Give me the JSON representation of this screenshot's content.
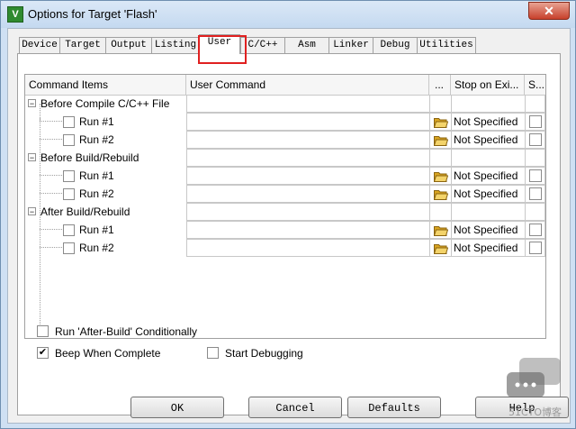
{
  "window": {
    "icon_letter": "V",
    "title": "Options for Target 'Flash'",
    "close_glyph": "✕"
  },
  "tabs": [
    {
      "label": "Device",
      "active": false
    },
    {
      "label": "Target",
      "active": false
    },
    {
      "label": "Output",
      "active": false
    },
    {
      "label": "Listing",
      "active": false
    },
    {
      "label": "User",
      "active": true
    },
    {
      "label": "C/C++",
      "active": false
    },
    {
      "label": "Asm",
      "active": false
    },
    {
      "label": "Linker",
      "active": false
    },
    {
      "label": "Debug",
      "active": false
    },
    {
      "label": "Utilities",
      "active": false
    }
  ],
  "grid": {
    "columns": {
      "items": "Command Items",
      "command": "User Command",
      "browse": "...",
      "stop": "Stop on Exi...",
      "s": "S..."
    },
    "groups": [
      {
        "label": "Before Compile C/C++ File",
        "expander": "−",
        "runs": [
          {
            "label": "Run #1",
            "command": "",
            "stop": "Not Specified"
          },
          {
            "label": "Run #2",
            "command": "",
            "stop": "Not Specified"
          }
        ]
      },
      {
        "label": "Before Build/Rebuild",
        "expander": "−",
        "runs": [
          {
            "label": "Run #1",
            "command": "",
            "stop": "Not Specified"
          },
          {
            "label": "Run #2",
            "command": "",
            "stop": "Not Specified"
          }
        ]
      },
      {
        "label": "After Build/Rebuild",
        "expander": "−",
        "runs": [
          {
            "label": "Run #1",
            "command": "",
            "stop": "Not Specified"
          },
          {
            "label": "Run #2",
            "command": "",
            "stop": "Not Specified"
          }
        ]
      }
    ]
  },
  "options": {
    "after_build": {
      "label": "Run 'After-Build' Conditionally",
      "checked": false
    },
    "beep": {
      "label": "Beep When Complete",
      "checked": true,
      "mark": "✔"
    },
    "start_debug": {
      "label": "Start Debugging",
      "checked": false
    }
  },
  "buttons": {
    "ok": "OK",
    "cancel": "Cancel",
    "defaults": "Defaults",
    "help": "Help"
  },
  "watermark": {
    "text": "51CTO博客"
  },
  "colors": {
    "active_tab_highlight": "#e02020",
    "title_bar": "#c4d9f0",
    "close_button": "#c7402b"
  }
}
